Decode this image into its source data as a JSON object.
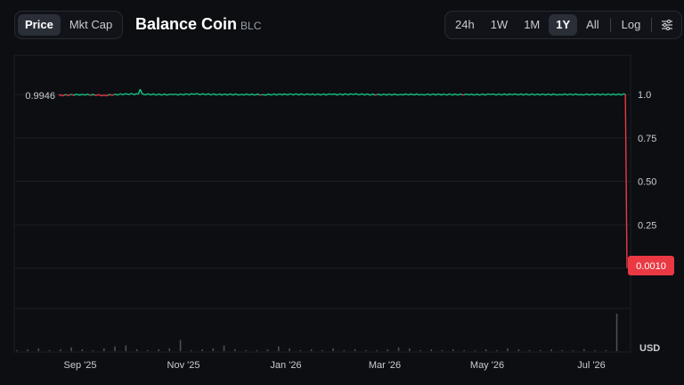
{
  "tabs": {
    "price": "Price",
    "mkt_cap": "Mkt Cap"
  },
  "coin": {
    "name": "Balance Coin",
    "symbol": "BLC"
  },
  "ranges": [
    "24h",
    "1W",
    "1M",
    "1Y",
    "All"
  ],
  "active_range": "1Y",
  "log_label": "Log",
  "settings_icon": "sliders-icon",
  "colors": {
    "up": "#16c784",
    "down": "#ea3943",
    "bg": "#0c0e12",
    "grid": "#1b1e24",
    "volume": "#4a4e56"
  },
  "chart_data": {
    "type": "line",
    "x_ticks": [
      "Sep '25",
      "Nov '25",
      "Jan '26",
      "Mar '26",
      "May '26",
      "Jul '26"
    ],
    "y_ticks": [
      "1.0",
      "0.75",
      "0.50",
      "0.25"
    ],
    "ylim": [
      0,
      1.05
    ],
    "start_label": "0.9946",
    "current_label": "0.0010",
    "currency_label": "USD",
    "series": [
      {
        "x": [
          "2025-08-12",
          "2025-08-26",
          "2025-09-09",
          "2025-09-23",
          "2025-10-07",
          "2025-10-21",
          "2025-11-04",
          "2025-11-18",
          "2025-12-02",
          "2025-12-16",
          "2025-12-30",
          "2026-01-13",
          "2026-01-27",
          "2026-02-10",
          "2026-02-24",
          "2026-03-10",
          "2026-03-24",
          "2026-04-07",
          "2026-04-21",
          "2026-05-05",
          "2026-05-19",
          "2026-06-02",
          "2026-06-16",
          "2026-06-30",
          "2026-07-14",
          "2026-07-27",
          "2026-07-28"
        ],
        "y": [
          0.9946,
          1.0,
          0.995,
          1.003,
          1.0,
          0.999,
          1.002,
          1.0,
          1.0,
          0.999,
          1.001,
          1.0,
          1.0,
          1.001,
          0.999,
          1.0,
          1.0,
          1.0,
          0.999,
          1.0,
          1.0,
          1.0,
          1.0,
          1.0,
          1.0,
          1.0,
          0.001
        ]
      }
    ],
    "volume": [
      1,
      2,
      3,
      1,
      2,
      4,
      2,
      1,
      3,
      5,
      6,
      2,
      1,
      2,
      3,
      12,
      1,
      2,
      3,
      6,
      2,
      1,
      1,
      2,
      5,
      3,
      1,
      2,
      1,
      3,
      1,
      2,
      1,
      1,
      2,
      4,
      3,
      1,
      2,
      1,
      2,
      1,
      1,
      2,
      1,
      3,
      2,
      1,
      1,
      2,
      1,
      1,
      2,
      1,
      1,
      40
    ]
  }
}
